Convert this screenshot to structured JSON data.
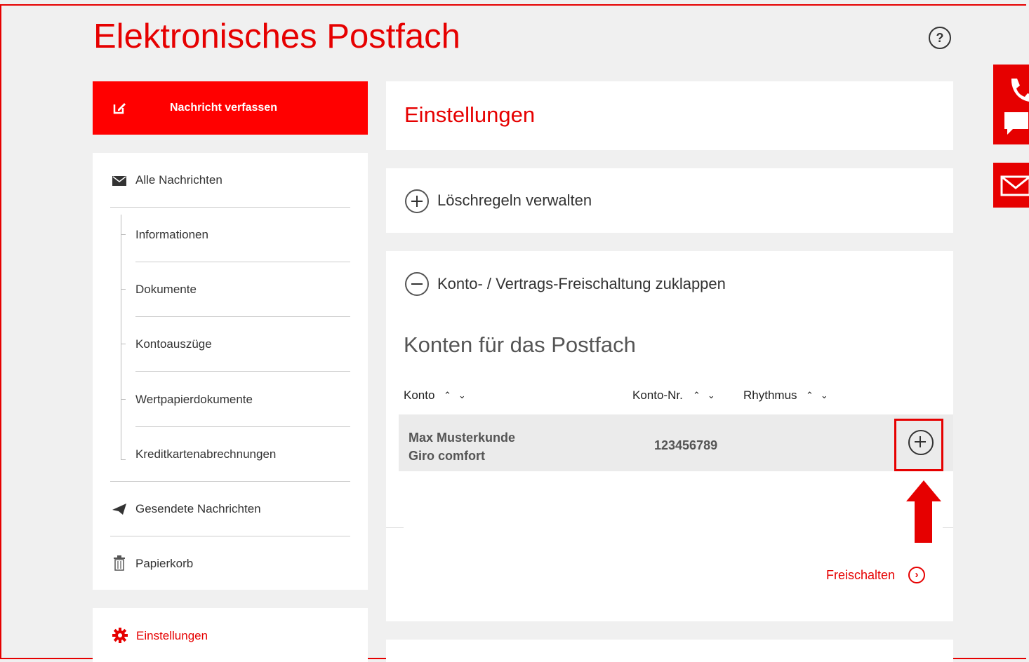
{
  "header": {
    "title": "Elektronisches Postfach",
    "help_label": "?"
  },
  "compose": {
    "label": "Nachricht verfassen"
  },
  "nav": {
    "all_messages": "Alle Nachrichten",
    "sub_items": [
      "Informationen",
      "Dokumente",
      "Kontoauszüge",
      "Wertpapierdokumente",
      "Kreditkartenabrechnungen"
    ],
    "sent": "Gesendete Nachrichten",
    "trash": "Papierkorb",
    "settings": "Einstellungen"
  },
  "main": {
    "title": "Einstellungen",
    "delete_rules": "Löschregeln verwalten",
    "account_toggle": "Konto- / Vertrags-Freischaltung zuklappen",
    "accounts_title": "Konten für das Postfach",
    "columns": [
      "Konto",
      "Konto-Nr.",
      "Rhythmus"
    ],
    "rows": [
      {
        "name": "Max Musterkunde",
        "product": "Giro comfort",
        "number": "123456789"
      }
    ],
    "unlock_label": "Freischalten"
  },
  "colors": {
    "accent": "#e60000",
    "background": "#f0f0f0"
  },
  "icons": [
    "edit-icon",
    "envelope-icon",
    "paper-plane-icon",
    "trash-icon",
    "gear-icon",
    "phone-icon",
    "chat-icon",
    "mail-icon",
    "help-icon"
  ]
}
